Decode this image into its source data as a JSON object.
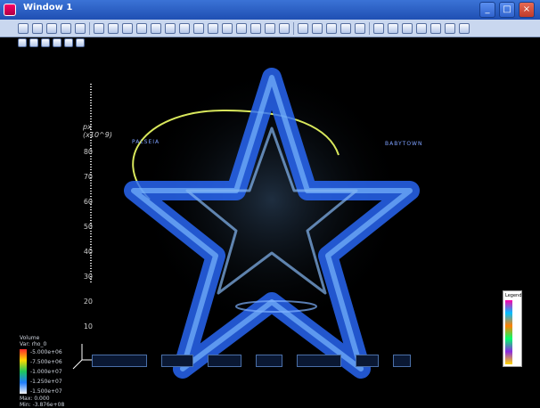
{
  "window": {
    "title": "Window 1",
    "close_label": "×",
    "maximize_label": "□",
    "minimize_label": "_"
  },
  "toolbar": {
    "row1_icons": [
      "new-icon",
      "open-icon",
      "save-icon",
      "delete-icon",
      "layout-icon",
      "grid-icon",
      "grid-icon",
      "grid-icon",
      "grid-icon",
      "grid-icon",
      "green-icon",
      "green-icon",
      "green-icon",
      "box-icon",
      "box-icon",
      "box-icon",
      "box-icon",
      "box-icon",
      "box-icon",
      "play-start-icon",
      "play-back-icon",
      "stop-icon",
      "play-forward-icon",
      "play-end-icon",
      "image-icon",
      "zoom-icon",
      "pan-icon",
      "rotate-icon",
      "pick-icon",
      "measure-icon",
      "graph-icon"
    ],
    "row2_icons": [
      "cube-icon",
      "pencil-icon",
      "paint-icon",
      "sphere-icon",
      "wand-icon",
      "lines-icon"
    ]
  },
  "plot": {
    "axis_unit_line1": "px",
    "axis_unit_line2": "(x10^9)",
    "ticks": [
      "80",
      "70",
      "60",
      "50",
      "40",
      "30",
      "20",
      "10"
    ],
    "star_label_left": "PALSEIA",
    "star_label_right": "BABYTOWN"
  },
  "legend_left": {
    "title": "Volume",
    "var": "Var: rho_0",
    "values": [
      "-5.000e+06",
      "-7.500e+06",
      "-1.000e+07",
      "-1.250e+07",
      "-1.500e+07"
    ],
    "max": "Max: 0.000",
    "min": "Min: -3.876e+08"
  },
  "legend_right": {
    "title": "Legend"
  },
  "colors": {
    "titlebar": "#2f62cc",
    "toolbar_bg": "#c9d7ef",
    "star_blue": "#2a6bff",
    "accent": "#9ad0ff"
  }
}
